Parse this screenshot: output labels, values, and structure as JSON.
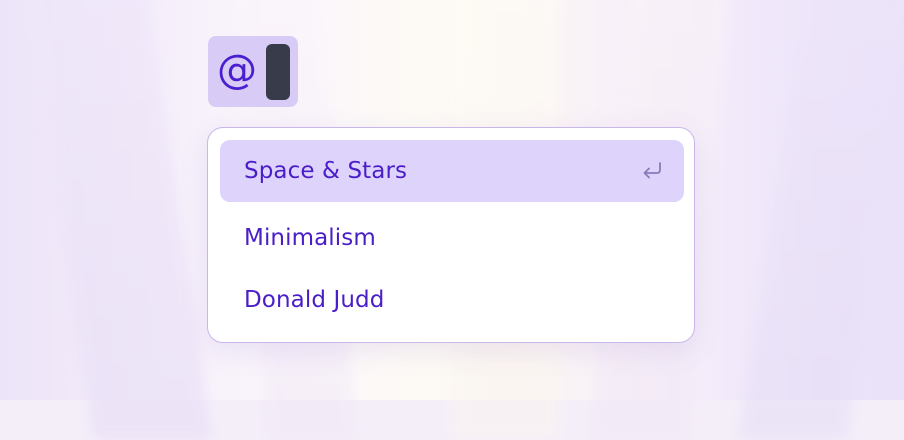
{
  "trigger": {
    "symbol": "@"
  },
  "menu": {
    "items": [
      {
        "label": "Space & Stars",
        "selected": true
      },
      {
        "label": "Minimalism",
        "selected": false
      },
      {
        "label": "Donald Judd",
        "selected": false
      }
    ],
    "enter_icon": "enter-return-icon"
  },
  "colors": {
    "accent": "#4a1dc8",
    "selected_bg": "#ddd3fb",
    "trigger_bg": "#d8cbf6",
    "caret": "#373b4a",
    "menu_border": "#c9b7ea"
  }
}
